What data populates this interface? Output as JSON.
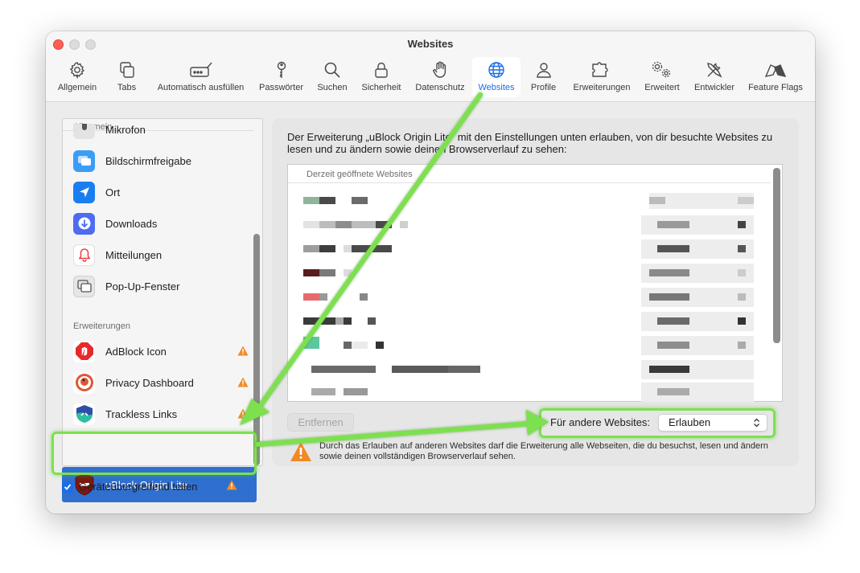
{
  "window": {
    "title": "Websites"
  },
  "toolbar": {
    "items": [
      {
        "label": "Allgemein",
        "icon": "gear-icon"
      },
      {
        "label": "Tabs",
        "icon": "tabs-icon"
      },
      {
        "label": "Automatisch ausfüllen",
        "icon": "autofill-icon"
      },
      {
        "label": "Passwörter",
        "icon": "key-icon"
      },
      {
        "label": "Suchen",
        "icon": "search-icon"
      },
      {
        "label": "Sicherheit",
        "icon": "lock-icon"
      },
      {
        "label": "Datenschutz",
        "icon": "hand-icon"
      },
      {
        "label": "Websites",
        "icon": "globe-icon",
        "active": true
      },
      {
        "label": "Profile",
        "icon": "person-icon"
      },
      {
        "label": "Erweiterungen",
        "icon": "puzzle-icon"
      },
      {
        "label": "Erweitert",
        "icon": "gears-icon"
      },
      {
        "label": "Entwickler",
        "icon": "tools-icon"
      },
      {
        "label": "Feature Flags",
        "icon": "flags-icon"
      }
    ]
  },
  "sidebar": {
    "section_general": "Allgemein",
    "general_items": [
      {
        "label": "Mikrofon",
        "icon": "microphone-icon"
      },
      {
        "label": "Bildschirmfreigabe",
        "icon": "screen-share-icon"
      },
      {
        "label": "Ort",
        "icon": "location-icon"
      },
      {
        "label": "Downloads",
        "icon": "download-icon"
      },
      {
        "label": "Mitteilungen",
        "icon": "bell-icon"
      },
      {
        "label": "Pop-Up-Fenster",
        "icon": "popup-window-icon"
      }
    ],
    "section_extensions": "Erweiterungen",
    "extension_items": [
      {
        "label": "AdBlock Icon",
        "icon": "adblock-icon",
        "warning": true
      },
      {
        "label": "Privacy Dashboard",
        "icon": "duckduckgo-icon",
        "warning": true
      },
      {
        "label": "Trackless Links",
        "icon": "trackless-links-icon",
        "warning": true
      },
      {
        "label": "uBlock Origin Lite",
        "icon": "ublock-icon",
        "warning": true,
        "selected": true
      }
    ],
    "share_label": "Geräteübergreifend teilen",
    "share_checked": true
  },
  "panel": {
    "description": "Der Erweiterung „uBlock Origin Lite“ mit den Einstellungen unten erlauben, von dir besuchte Websites zu lesen und zu ändern sowie deinen Browserverlauf zu sehen:",
    "sites_header": "Derzeit geöffnete Websites",
    "remove_label": "Entfernen",
    "other_sites_label": "Für andere Websites:",
    "other_sites_value": "Erlauben",
    "warning_text": "Durch das Erlauben auf anderen Websites darf die Erweiterung alle Webseiten, die du besuchst, lesen und ändern sowie deinen vollständigen Browserverlauf sehen.",
    "help_label": "?"
  },
  "colors": {
    "accent": "#1a6ee6",
    "selection": "#2f6fd0",
    "warning": "#f08a24",
    "annotation": "#7de04f"
  }
}
